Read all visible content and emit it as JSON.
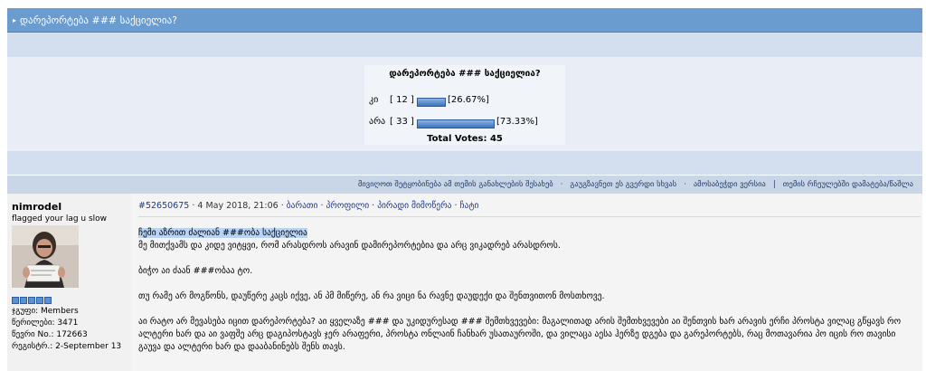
{
  "topic": {
    "title": "დარეპორტება ### საქციელია?",
    "arrow": "▸"
  },
  "poll": {
    "question": "დარეპორტება ### საქციელია?",
    "options": [
      {
        "label": "კი",
        "count": "[ 12 ]",
        "percent_text": "[26.67%]",
        "fraction": 0.2667
      },
      {
        "label": "არა",
        "count": "[ 33 ]",
        "percent_text": "[73.33%]",
        "fraction": 0.7333
      }
    ],
    "total": "Total Votes: 45",
    "bar_color": "#3b72c0"
  },
  "options_bar": {
    "items": [
      "მივიღოთ შეტყობინება ამ თემის განახლების შესახებ",
      "გაუგზავნეთ ეს გვერდი სხვას",
      "ამოსაბეჭდი ვერსია",
      "თემის რჩეულებში დამატება/წაშლა"
    ],
    "separators": [
      "·",
      "·",
      "|"
    ]
  },
  "post": {
    "author": "nimrodel",
    "author_title": "flagged your lag u slow",
    "group": "ჯგუფი: Members",
    "posts": "წერილები: 3471",
    "member_no": "წევრი No.: 172663",
    "registered": "რეგისტრ.: 2-September 13",
    "number": "#52650675",
    "date": " · 4 May 2018, 21:06 · ",
    "links": [
      "ბარათი",
      "პროფილი",
      "პირადი მიმოწერა",
      "ჩატი"
    ],
    "link_sep": " · ",
    "quote_line": "ჩემი აზრით ძალიან ###ობა საქციელია",
    "line1": "მე მითქვამს და კიდე ვიტყვი, რომ არასდროს არავინ დამირეპორტებია და არც ვიკადრებ არასდროს.",
    "line2": "ბიჭო აი ძაან ###ობაა ტო.",
    "line3": "თუ რამე არ მოგწონს, დაუწერე კაცს იქვე, ან პმ მიწერე, ან რა ვიცი ნა რავნე დაუდექი და შენთვითონ მოსთხოვე.",
    "line4": "აი რატო არ მევასება იცით დარეპორტება? აი ყველაზე ### და უკიდურესად ### შემთხვევები: მაგალითად არის შემთხვევები აი შენთვის ხარ არავის ერჩი პროსტა ვილაც გწყავს რო ალტერი ხარ და აი ვაფშე არც დაგიპოსტავს ჯერ არაფერი, პროსტა ონლაინ ჩანხარ უსათაუროში, და ვილაცა აესა ჰერზე დგება და გარეპორტებს, რაც მოთავარია პო იცის რო თავისი გაუვა და ალტერი ხარ და დააბანინებს შენს თავს."
  }
}
